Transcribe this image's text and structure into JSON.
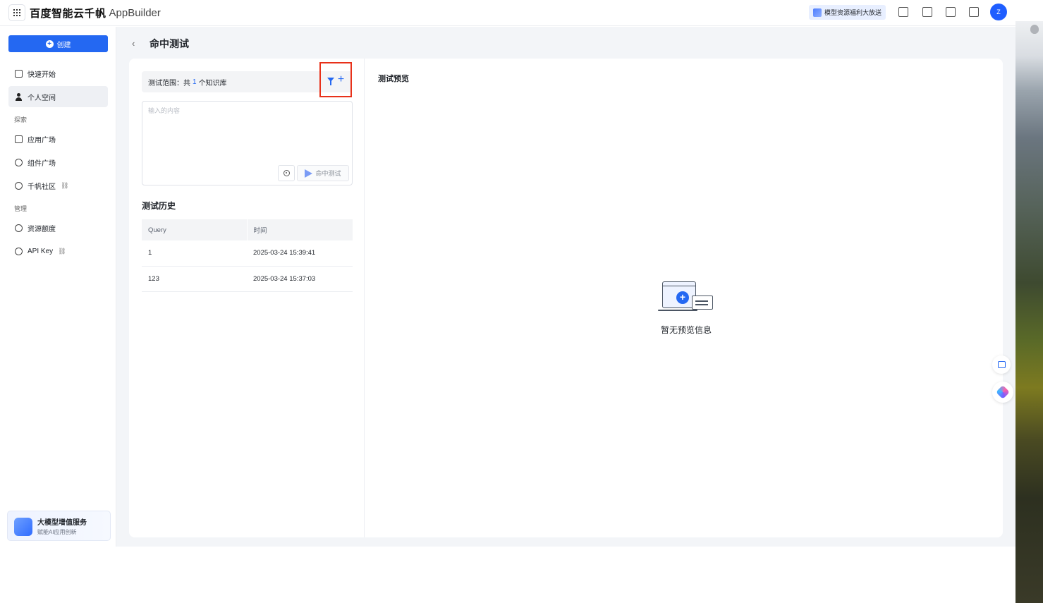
{
  "header": {
    "brand_main": "百度智能云千帆",
    "brand_sub": "AppBuilder",
    "promo_label": "模型资源福利大放送",
    "avatar_initial": "Z",
    "accent_color": "#2468f2"
  },
  "sidebar": {
    "create_label": "创建",
    "items": [
      {
        "label": "快速开始",
        "icon": "quickstart-icon"
      },
      {
        "label": "个人空间",
        "icon": "user-icon"
      }
    ],
    "group_explore": "探索",
    "explore_items": [
      {
        "label": "应用广场",
        "icon": "apps-icon"
      },
      {
        "label": "组件广场",
        "icon": "component-icon"
      },
      {
        "label": "千帆社区",
        "icon": "community-icon"
      }
    ],
    "group_manage": "管理",
    "manage_items": [
      {
        "label": "资源额度",
        "icon": "quota-icon"
      },
      {
        "label": "API Key",
        "icon": "key-icon"
      }
    ],
    "promo_title": "大模型增值服务",
    "promo_subtitle": "赋能AI应用创新"
  },
  "page": {
    "title": "命中测试",
    "scope_prefix": "测试范围：共",
    "scope_count": "1",
    "scope_suffix": "个知识库",
    "query_placeholder": "输入的内容",
    "test_button": "命中测试",
    "history_title": "测试历史",
    "history_columns": [
      "Query",
      "时间"
    ],
    "history_rows": [
      {
        "query": "1",
        "time": "2025-03-24 15:39:41"
      },
      {
        "query": "123",
        "time": "2025-03-24 15:37:03"
      }
    ],
    "preview_title": "测试预览",
    "empty_text": "暂无预览信息"
  }
}
